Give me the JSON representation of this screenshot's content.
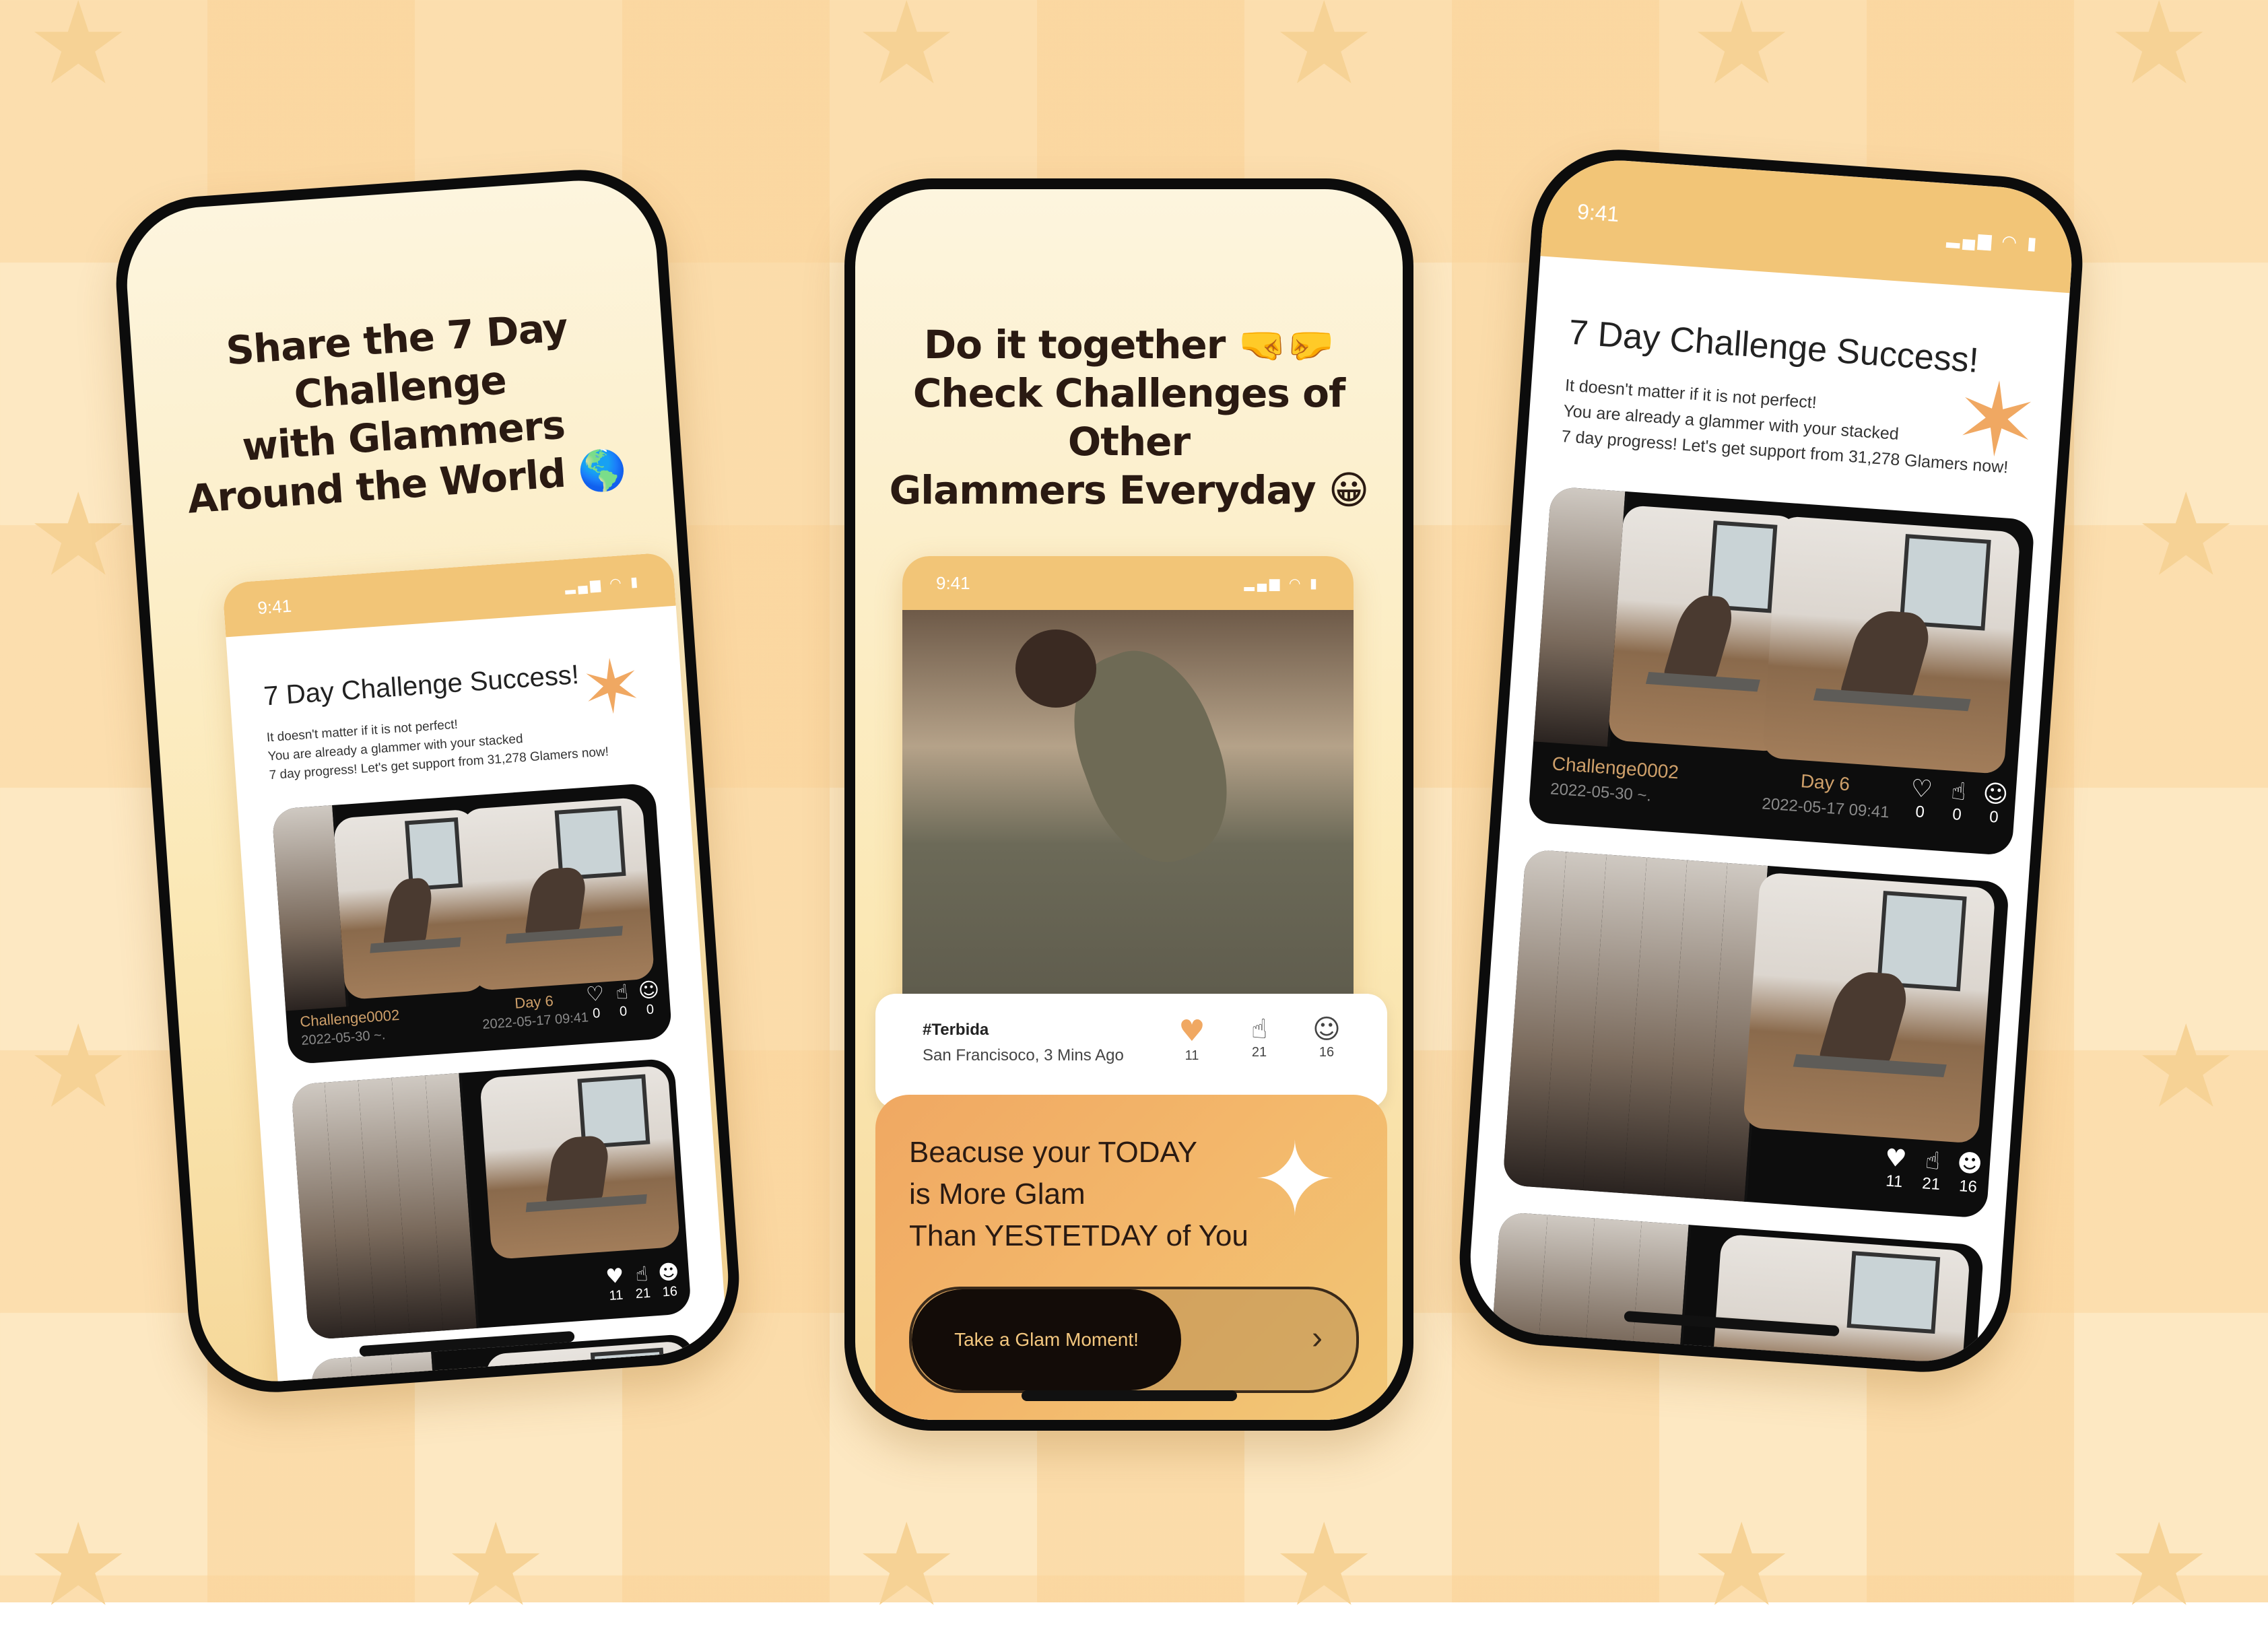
{
  "phone1": {
    "headline_line1": "Share the 7 Day Challenge",
    "headline_line2": "with Glammers",
    "headline_line3": "Around the World",
    "globe_icon": "🌎",
    "status_time": "9:41",
    "success_title": "7 Day Challenge Success!",
    "success_line1": "It doesn't matter if it is not perfect!",
    "success_line2": "You are already a glammer with your stacked",
    "success_line3": "7 day progress! Let's get support from 31,278 Glamers now!",
    "card1": {
      "challenge_label": "Challenge0002",
      "challenge_date": "2022-05-30 ~.",
      "day_label": "Day 6",
      "day_date": "2022-05-17 09:41",
      "counts": [
        "0",
        "0",
        "0"
      ]
    },
    "card2": {
      "counts": [
        "11",
        "21",
        "16"
      ]
    }
  },
  "phone2": {
    "headline_line1": "Do it together",
    "fist_icons": "🤜🤛",
    "headline_line2": "Check Challenges of Other",
    "headline_line3": "Glammers Everyday",
    "smile_icon": "😀",
    "status_time": "9:41",
    "post_user": "#Terbida",
    "post_location": "San Francisoco, 3 Mins Ago",
    "counts": [
      "11",
      "21",
      "16"
    ],
    "cta_line1": "Beacuse your TODAY",
    "cta_line2": "is More Glam",
    "cta_line3": "Than YESTETDAY of You",
    "cta_button": "Take a Glam Moment!",
    "cta_arrow": "›"
  },
  "phone3": {
    "status_time": "9:41",
    "success_title": "7 Day Challenge Success!",
    "success_line1": "It doesn't matter if it is not perfect!",
    "success_line2": "You are already a glammer with your stacked",
    "success_line3": "7 day progress! Let's get support from 31,278 Glamers now!",
    "card1": {
      "challenge_label": "Challenge0002",
      "challenge_date": "2022-05-30 ~.",
      "day_label": "Day 6",
      "day_date": "2022-05-17 09:41",
      "counts": [
        "0",
        "0",
        "0"
      ]
    },
    "card2": {
      "counts": [
        "11",
        "21",
        "16"
      ]
    }
  },
  "icons": {
    "heart": "♥",
    "thumb": "👍",
    "face": "😂",
    "sparkle": "✦",
    "signal": "▂▄▆",
    "wifi": "◠",
    "battery": "▮"
  },
  "colors": {
    "background": "#fde8c2",
    "accent": "#f2c577",
    "headline": "#2a1a12",
    "sparkle": "#f0a862"
  }
}
